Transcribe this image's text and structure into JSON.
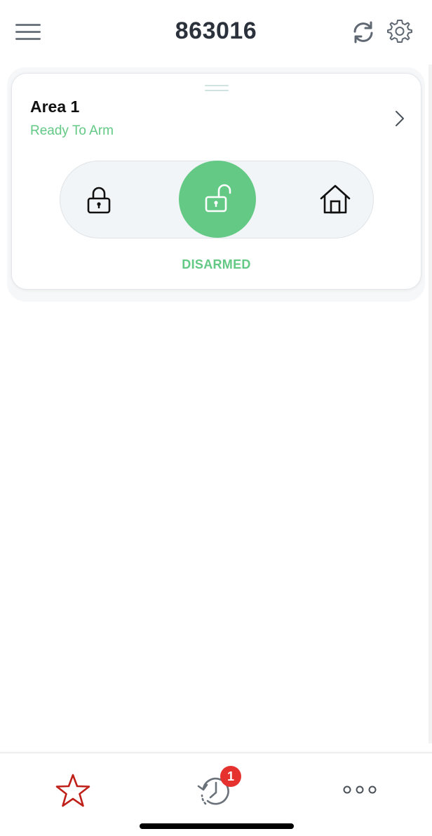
{
  "header": {
    "title": "863016",
    "menu_icon": "hamburger-menu-icon",
    "refresh_icon": "refresh-icon",
    "settings_icon": "gear-icon"
  },
  "area_card": {
    "name": "Area 1",
    "status": "Ready To Arm",
    "status_color": "#63c985",
    "modes": [
      {
        "name": "away-arm",
        "icon": "lock-closed-icon"
      },
      {
        "name": "disarm",
        "icon": "lock-open-icon",
        "selected": true
      },
      {
        "name": "home-arm",
        "icon": "house-icon"
      }
    ],
    "state_label": "DISARMED"
  },
  "tabbar": {
    "tabs": [
      {
        "name": "favorites",
        "icon": "star-icon",
        "color": "#c0201a"
      },
      {
        "name": "history",
        "icon": "history-clock-icon",
        "badge": "1"
      },
      {
        "name": "more",
        "icon": "more-dots-icon"
      }
    ],
    "badge_color": "#e5322f"
  }
}
